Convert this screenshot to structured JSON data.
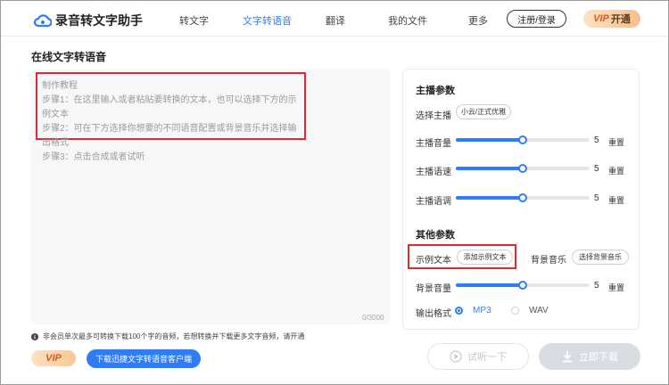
{
  "app": {
    "name": "录音转文字助手"
  },
  "nav": {
    "items": [
      {
        "label": "转文字"
      },
      {
        "label": "文字转语音"
      },
      {
        "label": "翻译"
      },
      {
        "label": "我的文件"
      },
      {
        "label": "更多"
      }
    ],
    "login": "注册/登录",
    "vip_v": "VIP",
    "vip_text": "开通"
  },
  "section_title": "在线文字转语音",
  "tutorial": {
    "title": "制作教程",
    "steps": [
      "步骤1：在这里输入或者粘贴要转换的文本，也可以选择下方的示例文本",
      "步骤2：可在下方选择你想要的不同语音配置或背景音乐并选择输出格式",
      "步骤3：点击合成或者试听"
    ]
  },
  "char_count": "0/3000",
  "notice": "非会员单次最多可转换下载100个字的音频，若想转换并下载更多文字音频，请开通",
  "vip_badge": "VIP",
  "download_client": "下载迅捷文字转语音客户端",
  "params": {
    "main_title": "主播参数",
    "voice_label": "选择主播",
    "voice_value": "小云/正式优雅",
    "sliders": [
      {
        "label": "主播音量",
        "value": "5",
        "level": 0.5,
        "reset": "重置"
      },
      {
        "label": "主播语速",
        "value": "5",
        "level": 0.5,
        "reset": "重置"
      },
      {
        "label": "主播语调",
        "value": "5",
        "level": 0.5,
        "reset": "重置"
      }
    ],
    "other_title": "其他参数",
    "sample_label": "示例文本",
    "sample_button": "添加示例文本",
    "bgm_label": "背景音乐",
    "bgm_button": "选择背景音乐",
    "bg_volume": {
      "label": "背景音量",
      "value": "5",
      "level": 0.5,
      "reset": "重置"
    },
    "format_label": "输出格式",
    "formats": [
      {
        "label": "MP3",
        "selected": true
      },
      {
        "label": "WAV",
        "selected": false
      }
    ]
  },
  "actions": {
    "listen": "试听一下",
    "download": "立即下载"
  },
  "colors": {
    "accent": "#2f7df6",
    "highlight": "#e8242e"
  }
}
